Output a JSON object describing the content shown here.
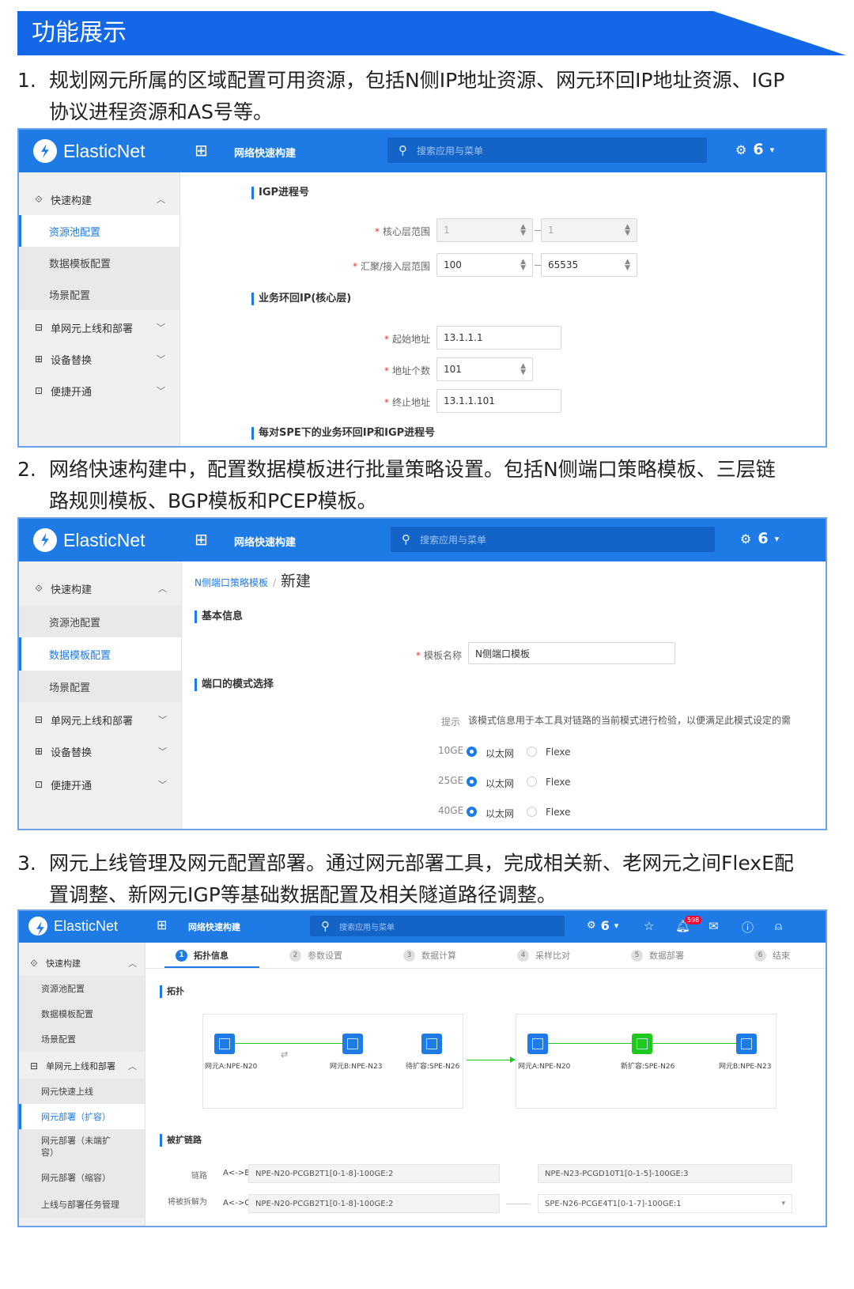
{
  "banner": {
    "title": "功能展示"
  },
  "items": [
    {
      "num": "1.",
      "line1": "规划网元所属的区域配置可用资源，包括N侧IP地址资源、网元环回IP地址资源、IGP",
      "line2": "协议进程资源和AS号等。"
    },
    {
      "num": "2.",
      "line1": "网络快速构建中，配置数据模板进行批量策略设置。包括N侧端口策略模板、三层链",
      "line2": "路规则模板、BGP模板和PCEP模板。"
    },
    {
      "num": "3.",
      "line1": "网元上线管理及网元配置部署。通过网元部署工具，完成相关新、老网元之间FlexE配",
      "line2": "置调整、新网元IGP等基础数据配置及相关隧道路径调整。"
    }
  ],
  "app": {
    "brand": "ElasticNet",
    "nav_title": "网络快速构建",
    "search_placeholder": "搜索应用与菜单",
    "count": "6"
  },
  "menu": {
    "quick_build": "快速构建",
    "resource_pool": "资源池配置",
    "data_template": "数据模板配置",
    "scene": "场景配置",
    "single_ne": "单网元上线和部署",
    "device_replace": "设备替换",
    "easy_open": "便捷开通",
    "ne_fast_online": "网元快速上线",
    "ne_deploy_expand": "网元部署（扩容）",
    "ne_deploy_unexpand": "网元部署（未端扩容）",
    "ne_deploy_shrink": "网元部署（缩容）",
    "task_mgmt": "上线与部署任务管理"
  },
  "shot1": {
    "sec_igp": "IGP进程号",
    "core_range": "核心层范围",
    "core_from": "1",
    "core_to": "1",
    "agg_range": "汇聚/接入层范围",
    "agg_from": "100",
    "agg_to": "65535",
    "sec_loop": "业务环回IP(核心层)",
    "start_addr_label": "起始地址",
    "start_addr": "13.1.1.1",
    "addr_count_label": "地址个数",
    "addr_count": "101",
    "end_addr_label": "终止地址",
    "end_addr": "13.1.1.101",
    "sec_spe": "每对SPE下的业务环回IP和IGP进程号"
  },
  "shot2": {
    "crumb_parent": "N侧端口策略模板",
    "crumb_current": "新建",
    "sec_basic": "基本信息",
    "tpl_name_label": "模板名称",
    "tpl_name": "N侧端口模板",
    "sec_mode": "端口的模式选择",
    "hint_label": "提示",
    "hint": "该模式信息用于本工具对链路的当前模式进行检验，以便满足此模式设定的需",
    "rows": [
      {
        "port": "10GE",
        "opt1": "以太网",
        "opt2": "Flexe"
      },
      {
        "port": "25GE",
        "opt1": "以太网",
        "opt2": "Flexe"
      },
      {
        "port": "40GE",
        "opt1": "以太网",
        "opt2": "Flexe"
      }
    ]
  },
  "shot3": {
    "notif_count": "598",
    "steps": [
      {
        "n": "1",
        "label": "拓扑信息"
      },
      {
        "n": "2",
        "label": "参数设置"
      },
      {
        "n": "3",
        "label": "数据计算"
      },
      {
        "n": "4",
        "label": "采样比对"
      },
      {
        "n": "5",
        "label": "数据部署"
      },
      {
        "n": "6",
        "label": "结束"
      }
    ],
    "sec_topo": "拓扑",
    "left_nodes": [
      "网元A:NPE-N20",
      "网元B:NPE-N23",
      "待扩容:SPE-N26"
    ],
    "right_nodes": [
      "网元A:NPE-N20",
      "新扩容:SPE-N26",
      "网元B:NPE-N23"
    ],
    "sec_link": "被扩链路",
    "row1_label": "链路",
    "row1_tag": "A<->B",
    "row1_a": "NPE-N20-PCGB2T1[0-1-8]-100GE:2",
    "row1_b": "NPE-N23-PCGD10T1[0-1-5]-100GE:3",
    "row2_label": "将被拆解为",
    "row2_tag": "A<->C",
    "row2_a": "NPE-N20-PCGB2T1[0-1-8]-100GE:2",
    "row2_b": "SPE-N26-PCGE4T1[0-1-7]-100GE:1"
  }
}
